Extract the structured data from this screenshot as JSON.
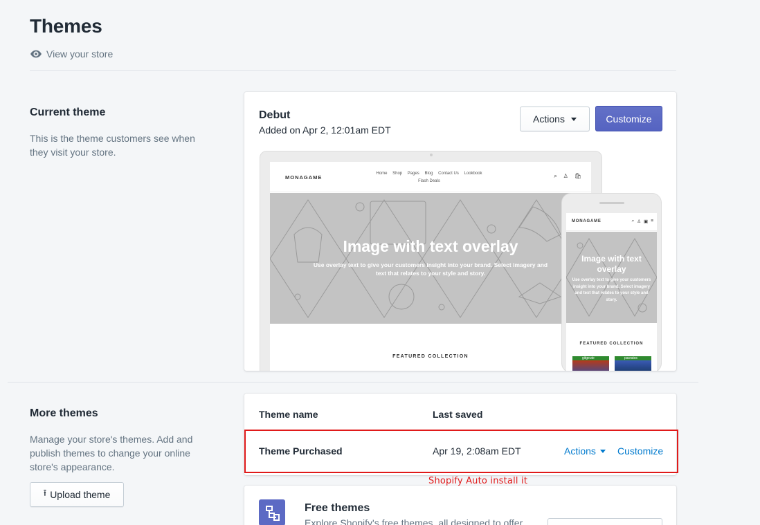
{
  "page": {
    "title": "Themes",
    "view_store": "View your store"
  },
  "current_theme": {
    "heading": "Current theme",
    "description": "This is the theme customers see when they visit your store.",
    "name": "Debut",
    "added": "Added on Apr 2, 12:01am EDT",
    "actions_label": "Actions",
    "customize_label": "Customize",
    "preview": {
      "logo": "MONAGAME",
      "nav": [
        "Home",
        "Shop",
        "Pages",
        "Blog",
        "Contact Us",
        "Lookbook",
        "Flash Deals"
      ],
      "hero_title": "Image with text overlay",
      "hero_subtitle": "Use overlay text to give your customers insight into your brand. Select imagery and text that relates to your style and story.",
      "featured": "FEATURED COLLECTION",
      "mobile_hero_title": "Image with text overlay",
      "mobile_hero_subtitle": "Use overlay text to give your customers insight into your brand. Select imagery and text that relates to your style and story.",
      "mobile_featured": "FEATURED COLLECTION",
      "product_labels": [
        "gitgeute",
        "pasraios"
      ]
    }
  },
  "more_themes": {
    "heading": "More themes",
    "description": "Manage your store's themes. Add and publish themes to change your online store's appearance.",
    "upload_label": "Upload theme",
    "columns": [
      "Theme name",
      "Last saved"
    ],
    "rows": [
      {
        "name": "Theme Purchased",
        "last_saved": "Apr 19, 2:08am EDT",
        "actions_label": "Actions",
        "customize_label": "Customize"
      }
    ],
    "annotation": "Shopify Auto install it"
  },
  "free_themes": {
    "title": "Free themes",
    "description": "Explore Shopify's free themes, all designed to offer"
  },
  "colors": {
    "primary": "#5c6ac4",
    "link": "#007ace",
    "highlight": "#e01a1a"
  }
}
